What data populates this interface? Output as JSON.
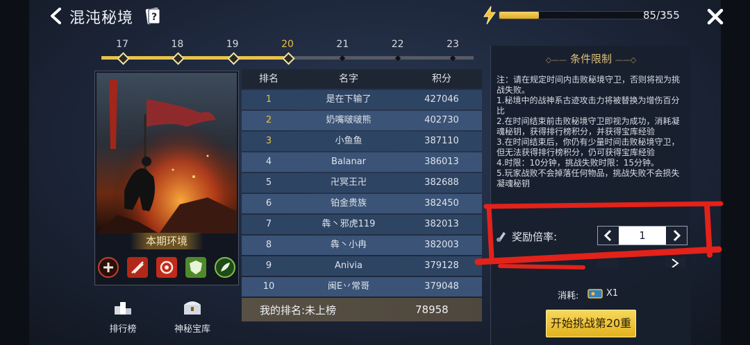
{
  "header": {
    "title": "混沌秘境",
    "energy_text": "85/355",
    "energy_fraction": 0.24
  },
  "levels": {
    "items": [
      "17",
      "18",
      "19",
      "20",
      "21",
      "22",
      "23"
    ],
    "active": "20"
  },
  "environment": {
    "label": "本期环境"
  },
  "bottom_buttons": {
    "leaderboard": "排行榜",
    "treasury": "神秘宝库"
  },
  "ranking": {
    "headers": [
      "排名",
      "名字",
      "积分"
    ],
    "rows": [
      {
        "rank": "1",
        "name": "是在下输了",
        "score": "427046"
      },
      {
        "rank": "2",
        "name": "奶嘴啵啵熊",
        "score": "402730"
      },
      {
        "rank": "3",
        "name": "小鱼鱼",
        "score": "387110"
      },
      {
        "rank": "4",
        "name": "Balanar",
        "score": "386013"
      },
      {
        "rank": "5",
        "name": "卍冥王卍",
        "score": "382688"
      },
      {
        "rank": "6",
        "name": "铂金贵族",
        "score": "382450"
      },
      {
        "rank": "7",
        "name": "犇丶邪虎119",
        "score": "382013"
      },
      {
        "rank": "8",
        "name": "犇丶小冉",
        "score": "382003"
      },
      {
        "rank": "9",
        "name": "Anivia",
        "score": "379128"
      },
      {
        "rank": "10",
        "name": "闽E丷常哥",
        "score": "379048"
      }
    ],
    "my_rank_label": "我的排名:未上榜",
    "my_score": "78958"
  },
  "conditions": {
    "title": "条件限制",
    "lines": [
      "注：请在规定时间内击败秘境守卫，否则将视为挑战失败。",
      "1.秘境中的战神系古迹攻击力将被替换为增伤百分比",
      "2.在时间结束前击败秘境守卫即视为成功，消耗凝魂秘钥，获得排行榜积分，并获得宝库经验",
      "3.在时间结束后，你仍有少量时间击败秘境守卫，但无法获得排行榜积分，仍可获得宝库经验",
      "4.时限：10分钟，挑战失败时限：15分钟。",
      "5.玩家战败不会掉落任何物品，挑战失败不会损失凝魂秘钥"
    ]
  },
  "reward": {
    "label": "奖励倍率:",
    "value": "1"
  },
  "cost": {
    "label": "消耗:",
    "qty": "X1"
  },
  "start_button": "开始挑战第20重",
  "colors": {
    "accent_gold": "#e8c24a",
    "annotation_red": "#e3221a",
    "row_blue": "#2e4463"
  }
}
